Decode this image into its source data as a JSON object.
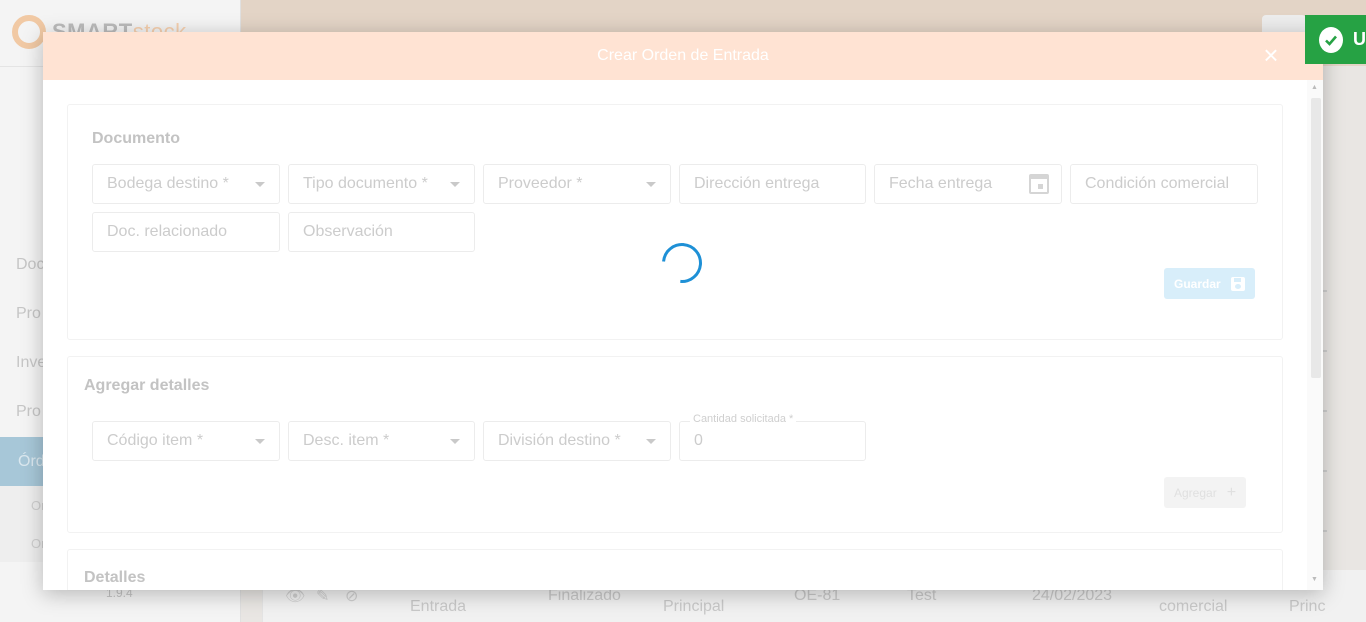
{
  "background": {
    "logo": {
      "brand_bold": "SMART",
      "brand_light": "stock"
    },
    "nav": [
      {
        "label": "Doc",
        "active": false
      },
      {
        "label": "Pro",
        "active": false
      },
      {
        "label": "Inve",
        "active": false
      },
      {
        "label": "Pro",
        "active": false
      },
      {
        "label": "Órd",
        "active": true
      }
    ],
    "subnav": [
      "Or",
      "Or"
    ],
    "version": "1.9.4",
    "row": {
      "col1": "Entrada",
      "col2": "Finalizado",
      "col3": "Principal",
      "col4": "OE-81",
      "col5": "Test",
      "col6": "24/02/2023",
      "col7": "comercial",
      "col8": "Princ"
    }
  },
  "toast": {
    "text": "U",
    "color": "#26a244"
  },
  "modal": {
    "title": "Crear Orden de Entrada",
    "documento": {
      "title": "Documento",
      "fields": [
        {
          "placeholder": "Bodega destino *",
          "type": "select"
        },
        {
          "placeholder": "Tipo documento *",
          "type": "select"
        },
        {
          "placeholder": "Proveedor *",
          "type": "select"
        },
        {
          "placeholder": "Dirección entrega",
          "type": "text"
        },
        {
          "placeholder": "Fecha entrega",
          "type": "date"
        },
        {
          "placeholder": "Condición comercial",
          "type": "text"
        },
        {
          "placeholder": "Doc. relacionado",
          "type": "text"
        },
        {
          "placeholder": "Observación",
          "type": "text"
        }
      ],
      "save_label": "Guardar"
    },
    "agregar_detalles": {
      "title": "Agregar detalles",
      "fields": [
        {
          "placeholder": "Código item *",
          "type": "select"
        },
        {
          "placeholder": "Desc. item *",
          "type": "select"
        },
        {
          "placeholder": "División destino *",
          "type": "select"
        }
      ],
      "cantidad": {
        "label": "Cantidad solicitada *",
        "value": "0"
      },
      "add_label": "Agregar",
      "add_icon": "+"
    },
    "detalles": {
      "title": "Detalles"
    }
  },
  "colors": {
    "accent": "#1e90d6",
    "header": "#ffe3d3"
  }
}
